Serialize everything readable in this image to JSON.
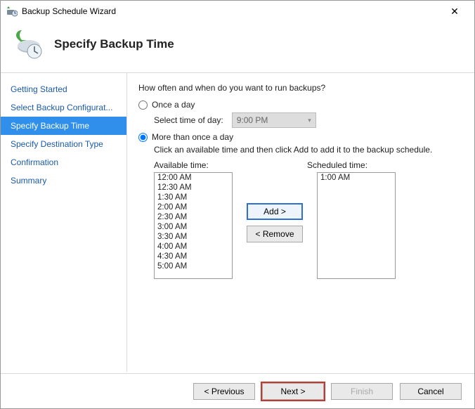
{
  "window": {
    "title": "Backup Schedule Wizard"
  },
  "header": {
    "title": "Specify Backup Time"
  },
  "sidebar": {
    "items": [
      {
        "label": "Getting Started"
      },
      {
        "label": "Select Backup Configurat..."
      },
      {
        "label": "Specify Backup Time"
      },
      {
        "label": "Specify Destination Type"
      },
      {
        "label": "Confirmation"
      },
      {
        "label": "Summary"
      }
    ],
    "selected_index": 2
  },
  "content": {
    "question": "How often and when do you want to run backups?",
    "once": {
      "label": "Once a day",
      "time_label": "Select time of day:",
      "time_value": "9:00 PM"
    },
    "multi": {
      "label": "More than once a day",
      "desc": "Click an available time and then click Add to add it to the backup schedule.",
      "available_label": "Available time:",
      "scheduled_label": "Scheduled time:",
      "add_label": "Add >",
      "remove_label": "< Remove",
      "available": [
        "12:00 AM",
        "12:30 AM",
        "1:30 AM",
        "2:00 AM",
        "2:30 AM",
        "3:00 AM",
        "3:30 AM",
        "4:00 AM",
        "4:30 AM",
        "5:00 AM"
      ],
      "scheduled": [
        "1:00 AM"
      ]
    },
    "selected_option": "multi"
  },
  "footer": {
    "previous": "< Previous",
    "next": "Next >",
    "finish": "Finish",
    "cancel": "Cancel"
  }
}
